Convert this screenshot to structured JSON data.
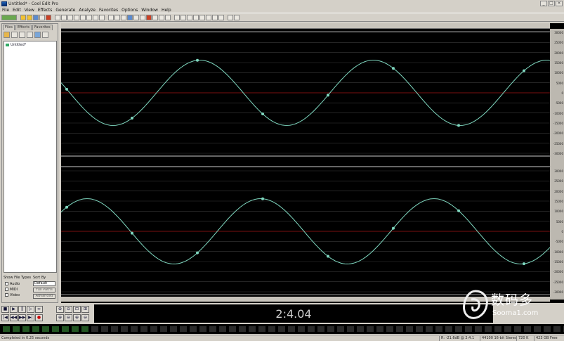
{
  "window": {
    "title": "Untitled* - Cool Edit Pro",
    "controls": [
      "_",
      "□",
      "×"
    ]
  },
  "menu": [
    "File",
    "Edit",
    "View",
    "Effects",
    "Generate",
    "Analyze",
    "Favorites",
    "Options",
    "Window",
    "Help"
  ],
  "left_panel": {
    "tabs": [
      "Files",
      "Effects",
      "Favorites"
    ],
    "active_tab": "Files",
    "file_item": "Untitled*",
    "show_file_types_label": "Show File Types",
    "sort_by_label": "Sort By",
    "file_types": [
      "Audio",
      "MIDI",
      "Video"
    ],
    "sort_value": "Default",
    "buttons": [
      "Full Paths",
      "Advanced"
    ]
  },
  "waveform": {
    "channels": 2,
    "background": "#000000",
    "wave_color": "#7fd8c0",
    "center_line_color": "#7a1010",
    "grid_color": "#3a3a3a"
  },
  "amplitude_scale": [
    "30000",
    "25000",
    "20000",
    "15000",
    "10000",
    "5000",
    "0",
    "-5000",
    "-10000",
    "-15000",
    "-20000",
    "-25000",
    "-30000"
  ],
  "time_display": "2:4.04",
  "status": {
    "message": "Completed in 0.25 seconds",
    "level": "R: -21.6dB @ 2:4.1",
    "format": "44100 16-bit Stereo",
    "size": "720 K",
    "free": "423 GB Free"
  },
  "watermark": {
    "text": "数码多",
    "sub": "Sooma1.com"
  }
}
